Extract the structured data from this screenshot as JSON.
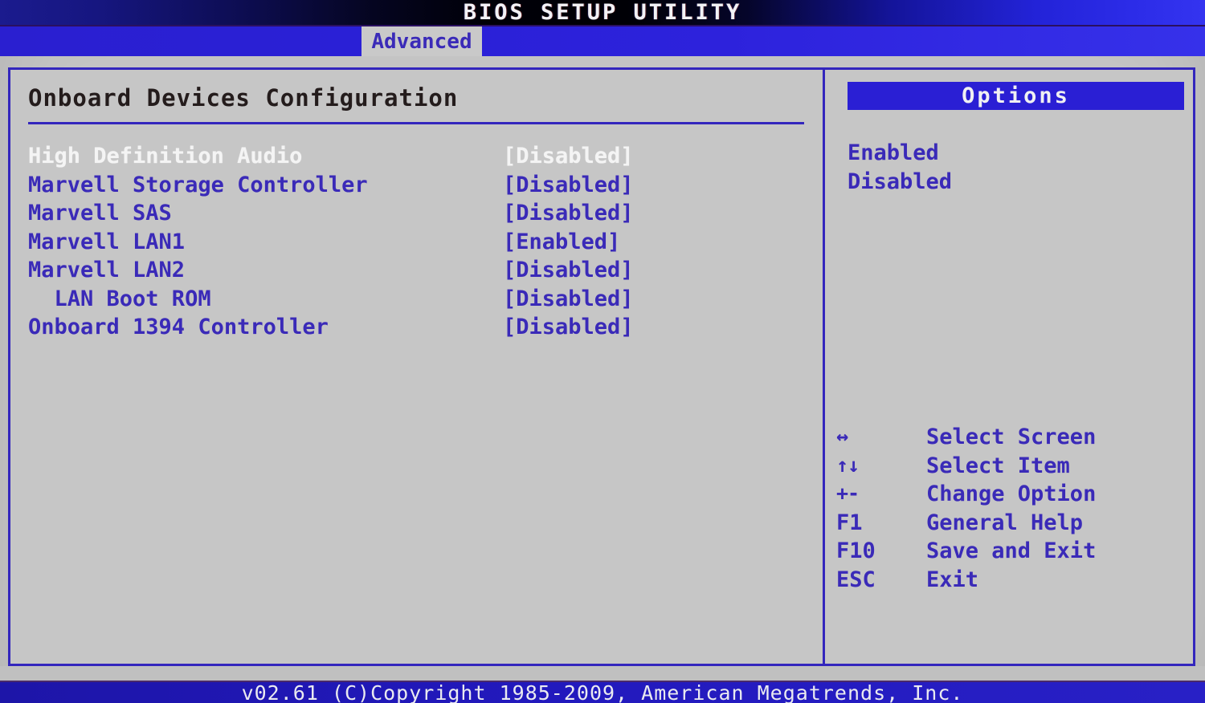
{
  "window": {
    "title": "BIOS SETUP UTILITY",
    "footer": "v02.61 (C)Copyright 1985-2009, American Megatrends, Inc."
  },
  "colors": {
    "accent_blue": "#3326bd",
    "text_blue": "#3a2ab8",
    "selected_text": "#f4f4f4",
    "panel_bg": "#c6c6c6",
    "header_bar_blue": "#2a1fd4",
    "title_bar_dark": "#000006"
  },
  "tabs": [
    {
      "label": "Advanced",
      "active": true
    }
  ],
  "main": {
    "title": "Onboard Devices Configuration",
    "settings": [
      {
        "label": "High Definition Audio",
        "value": "[Disabled]",
        "selected": true
      },
      {
        "label": "Marvell Storage Controller",
        "value": "[Disabled]",
        "selected": false
      },
      {
        "label": "Marvell SAS",
        "value": "[Disabled]",
        "selected": false
      },
      {
        "label": "Marvell LAN1",
        "value": "[Enabled]",
        "selected": false
      },
      {
        "label": "Marvell LAN2",
        "value": "[Disabled]",
        "selected": false
      },
      {
        "label": "  LAN Boot ROM",
        "value": "[Disabled]",
        "selected": false
      },
      {
        "label": "Onboard 1394 Controller",
        "value": "[Disabled]",
        "selected": false
      }
    ]
  },
  "options_panel": {
    "header": "Options",
    "items": [
      {
        "label": "Enabled"
      },
      {
        "label": "Disabled"
      }
    ],
    "legend": [
      {
        "key": "↔",
        "icon": "left-right-arrow-icon",
        "desc": "Select Screen",
        "glyph": true
      },
      {
        "key": "↑↓",
        "icon": "up-down-arrow-icon",
        "desc": "Select Item",
        "glyph": true
      },
      {
        "key": "+-",
        "icon": "plus-minus-icon",
        "desc": "Change Option",
        "glyph": true
      },
      {
        "key": "F1",
        "icon": "f1-key-icon",
        "desc": "General Help",
        "glyph": false
      },
      {
        "key": "F10",
        "icon": "f10-key-icon",
        "desc": "Save and Exit",
        "glyph": false
      },
      {
        "key": "ESC",
        "icon": "esc-key-icon",
        "desc": "Exit",
        "glyph": false
      }
    ]
  }
}
